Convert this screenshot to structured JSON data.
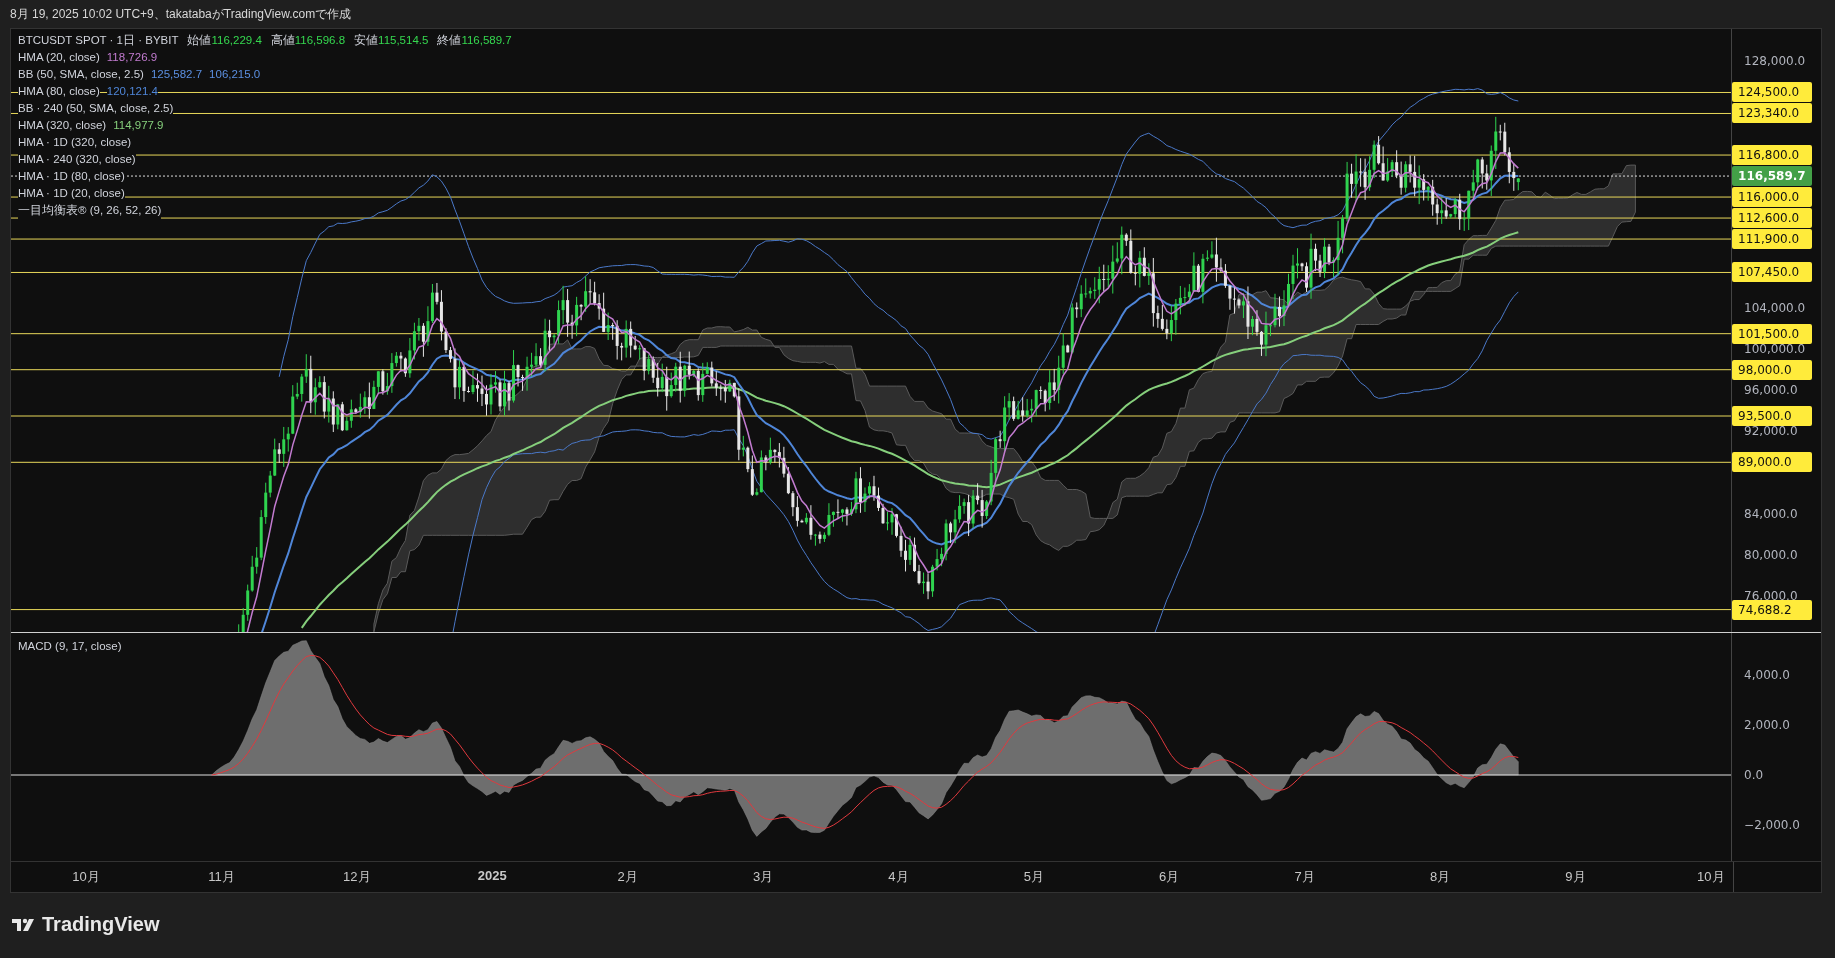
{
  "header": {
    "caption": "8月 19, 2025 10:02 UTC+9、takatabaがTradingView.comで作成"
  },
  "legend": {
    "symbol": "BTCUSDT SPOT · 1日 · BYBIT",
    "ohlc": [
      {
        "label": "始値",
        "value": "116,229.4"
      },
      {
        "label": "高値",
        "value": "116,596.8"
      },
      {
        "label": "安値",
        "value": "115,514.5"
      },
      {
        "label": "終値",
        "value": "116,589.7"
      }
    ]
  },
  "indicators": [
    {
      "name": "HMA (20, close)",
      "values": [
        {
          "text": "118,726.9",
          "color": "#c27bd0"
        }
      ]
    },
    {
      "name": "BB (50, SMA, close, 2.5)",
      "values": [
        {
          "text": "125,582.7",
          "color": "#5b8fe0"
        },
        {
          "text": "106,215.0",
          "color": "#5b8fe0"
        }
      ]
    },
    {
      "name": "HMA (80, close)",
      "values": [
        {
          "text": "120,121.4",
          "color": "#4f86d8"
        }
      ]
    },
    {
      "name": "BB · 240 (50, SMA, close, 2.5)"
    },
    {
      "name": "HMA (320, close)",
      "values": [
        {
          "text": "114,977.9",
          "color": "#86cf7c"
        }
      ]
    },
    {
      "name": "HMA · 1D (320, close)"
    },
    {
      "name": "HMA · 240 (320, close)"
    },
    {
      "name": "HMA · 1D (80, close)"
    },
    {
      "name": "HMA · 1D (20, close)"
    },
    {
      "name": "一目均衡表® (9, 26, 52, 26)"
    }
  ],
  "price_axis": {
    "ticks": [
      "128,000.0",
      "104,000.0",
      "100,000.0",
      "96,000.0",
      "92,000.0",
      "84,000.0",
      "80,000.0",
      "76,000.0"
    ]
  },
  "price_levels": [
    {
      "label": "124,500.0",
      "kind": "level"
    },
    {
      "label": "123,340.0",
      "kind": "level"
    },
    {
      "label": "116,800.0",
      "kind": "level"
    },
    {
      "label": "116,589.7",
      "kind": "last"
    },
    {
      "label": "116,000.0",
      "kind": "level"
    },
    {
      "label": "112,600.0",
      "kind": "level"
    },
    {
      "label": "111,900.0",
      "kind": "level"
    },
    {
      "label": "107,450.0",
      "kind": "level"
    },
    {
      "label": "101,500.0",
      "kind": "level"
    },
    {
      "label": "98,000.0",
      "kind": "level"
    },
    {
      "label": "93,500.0",
      "kind": "level"
    },
    {
      "label": "89,000.0",
      "kind": "level"
    },
    {
      "label": "74,688.2",
      "kind": "level"
    }
  ],
  "macd": {
    "title": "MACD (9, 17, close)",
    "ticks": [
      "4,000.0",
      "2,000.0",
      "0.0",
      "−2,000.0"
    ]
  },
  "time_axis": {
    "labels": [
      {
        "text": "10月",
        "bold": false
      },
      {
        "text": "11月",
        "bold": false
      },
      {
        "text": "12月",
        "bold": false
      },
      {
        "text": "2025",
        "bold": true
      },
      {
        "text": "2月",
        "bold": false
      },
      {
        "text": "3月",
        "bold": false
      },
      {
        "text": "4月",
        "bold": false
      },
      {
        "text": "5月",
        "bold": false
      },
      {
        "text": "6月",
        "bold": false
      },
      {
        "text": "7月",
        "bold": false
      },
      {
        "text": "8月",
        "bold": false
      },
      {
        "text": "9月",
        "bold": false
      },
      {
        "text": "10月",
        "bold": false
      }
    ]
  },
  "footer": {
    "brand": "TradingView"
  }
}
